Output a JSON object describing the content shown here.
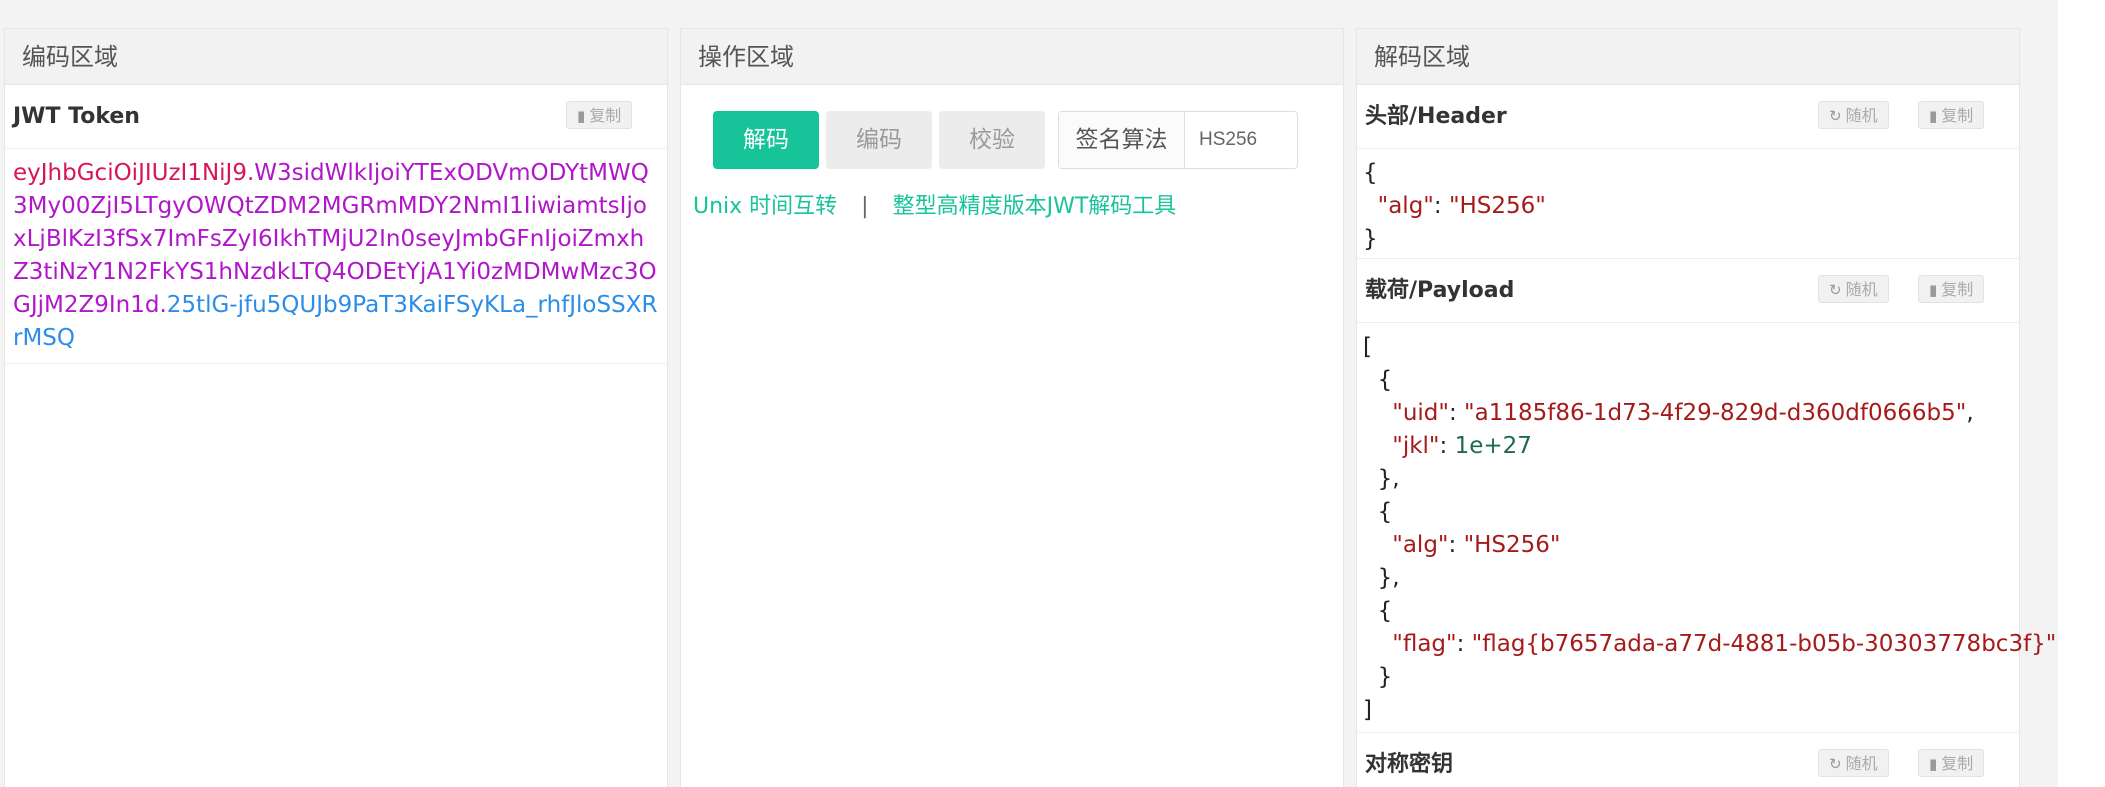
{
  "panels": {
    "encode_title": "编码区域",
    "ops_title": "操作区域",
    "decode_title": "解码区域"
  },
  "encode": {
    "section_title": "JWT Token",
    "copy_label": "复制",
    "token_header": "eyJhbGciOiJIUzI1NiJ9",
    "dot1": ".",
    "token_payload": "W3sidWlkIjoiYTExODVmODYtMWQ3My00ZjI5LTgyOWQtZDM2MGRmMDY2NmI1IiwiamtsIjoxLjBlKzI3fSx7ImFsZyI6IkhTMjU2In0seyJmbGFnIjoiZmxhZ3tiNzY1N2FkYS1hNzdkLTQ4ODEtYjA1Yi0zMDMwMzc3OGJjM2Z9In1d",
    "dot2": ".",
    "token_signature": "25tlG-jfu5QUJb9PaT3KaiFSyKLa_rhfJloSSXRrMSQ"
  },
  "ops": {
    "decode_btn": "解码",
    "encode_btn": "编码",
    "verify_btn": "校验",
    "alg_label": "签名算法",
    "alg_value": "HS256",
    "link_unix": "Unix 时间互转",
    "link_sep": "|",
    "link_bigint": "整型高精度版本JWT解码工具"
  },
  "decode": {
    "header_title": "头部/Header",
    "payload_title": "载荷/Payload",
    "secret_title": "对称密钥",
    "random_label": "随机",
    "copy_label": "复制",
    "header_json": {
      "open": "{",
      "k_alg": "\"alg\"",
      "v_alg": "\"HS256\"",
      "close": "}"
    },
    "payload_json": {
      "open_arr": "[",
      "close_arr": "]",
      "k_uid": "\"uid\"",
      "v_uid": "\"a1185f86-1d73-4f29-829d-d360df0666b5\"",
      "k_jkl": "\"jkl\"",
      "v_jkl": "1e+27",
      "k_alg": "\"alg\"",
      "v_alg": "\"HS256\"",
      "k_flag": "\"flag\"",
      "v_flag": "\"flag{b7657ada-a77d-4881-b05b-30303778bc3f}\""
    }
  },
  "colors": {
    "accent": "#17c49a",
    "token_header": "#d8145a",
    "token_payload": "#b017c9",
    "token_signature": "#2b8de8",
    "json_string": "#a51b1b",
    "json_number": "#1e6a4d"
  }
}
